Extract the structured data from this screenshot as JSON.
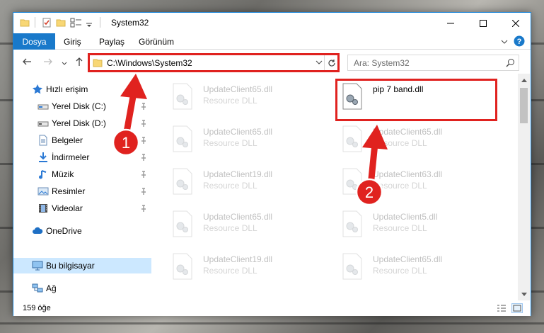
{
  "window": {
    "title": "System32",
    "controls": {
      "minimize": "minimize",
      "maximize": "maximize",
      "close": "close"
    }
  },
  "ribbon": {
    "tabs": [
      "Dosya",
      "Giriş",
      "Paylaş",
      "Görünüm"
    ]
  },
  "address": {
    "path": "C:\\Windows\\System32"
  },
  "search": {
    "placeholder": "Ara: System32"
  },
  "navigation": {
    "items": [
      {
        "label": "Hızlı erişim",
        "icon": "star-icon",
        "pinned": false
      },
      {
        "label": "Yerel Disk (C:)",
        "icon": "drive-icon",
        "pinned": true
      },
      {
        "label": "Yerel Disk (D:)",
        "icon": "drive-icon",
        "pinned": true
      },
      {
        "label": "Belgeler",
        "icon": "document-icon",
        "pinned": true
      },
      {
        "label": "İndirmeler",
        "icon": "download-icon",
        "pinned": true
      },
      {
        "label": "Müzik",
        "icon": "music-icon",
        "pinned": true
      },
      {
        "label": "Resimler",
        "icon": "pictures-icon",
        "pinned": true
      },
      {
        "label": "Videolar",
        "icon": "video-icon",
        "pinned": true
      },
      {
        "label": "OneDrive",
        "icon": "cloud-icon",
        "pinned": false
      },
      {
        "label": "Bu bilgisayar",
        "icon": "computer-icon",
        "pinned": false,
        "selected": true
      },
      {
        "label": "Ağ",
        "icon": "network-icon",
        "pinned": false
      }
    ]
  },
  "files": [
    {
      "name": "UpdateClient65.dll",
      "type": "Resource DLL",
      "highlighted": false
    },
    {
      "name": "pip 7 band.dll",
      "type": "",
      "highlighted": true
    },
    {
      "name": "UpdateClient65.dll",
      "type": "Resource DLL",
      "highlighted": false
    },
    {
      "name": "UpdateClient65.dll",
      "type": "Resource DLL",
      "highlighted": false
    },
    {
      "name": "UpdateClient19.dll",
      "type": "Resource DLL",
      "highlighted": false
    },
    {
      "name": "UpdateClient63.dll",
      "type": "Resource DLL",
      "highlighted": false
    },
    {
      "name": "UpdateClient65.dll",
      "type": "Resource DLL",
      "highlighted": false
    },
    {
      "name": "UpdateClient5.dll",
      "type": "Resource DLL",
      "highlighted": false
    },
    {
      "name": "UpdateClient19.dll",
      "type": "Resource DLL",
      "highlighted": false
    },
    {
      "name": "UpdateClient65.dll",
      "type": "Resource DLL",
      "highlighted": false
    }
  ],
  "status": {
    "item_count": "159 öğe"
  },
  "annotations": {
    "step1": "1",
    "step2": "2",
    "color": "#e0221f"
  },
  "colors": {
    "accent": "#1979ca",
    "selected_bg": "#cce8ff"
  }
}
